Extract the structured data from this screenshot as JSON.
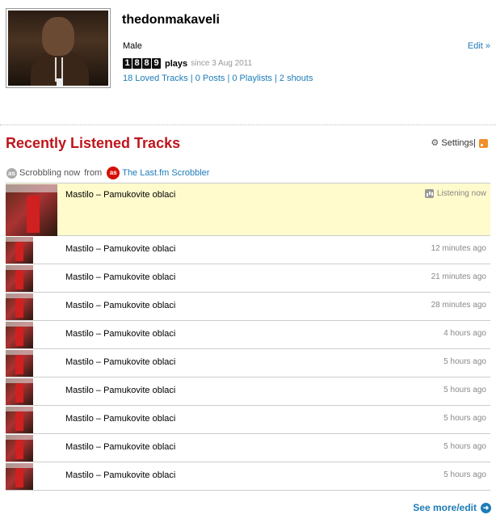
{
  "profile": {
    "username": "thedonmakaveli",
    "gender": "Male",
    "edit_label": "Edit »",
    "play_digits": [
      "1",
      "8",
      "8",
      "9"
    ],
    "plays_label": "plays",
    "since": "since 3 Aug 2011",
    "stats": {
      "loved": "18 Loved Tracks",
      "posts": "0 Posts",
      "playlists": "0 Playlists",
      "shouts": "2 shouts",
      "separator": " | "
    }
  },
  "section": {
    "title": "Recently Listened Tracks",
    "settings_label": "Settings",
    "settings_sep": " |"
  },
  "scrobbling": {
    "label": "Scrobbling now",
    "from": "from",
    "source": "The Last.fm Scrobbler"
  },
  "tracks": [
    {
      "name": "Mastilo – Pamukovite oblaci",
      "time": "Listening now"
    },
    {
      "name": "Mastilo – Pamukovite oblaci",
      "time": "12 minutes ago"
    },
    {
      "name": "Mastilo – Pamukovite oblaci",
      "time": "21 minutes ago"
    },
    {
      "name": "Mastilo – Pamukovite oblaci",
      "time": "28 minutes ago"
    },
    {
      "name": "Mastilo – Pamukovite oblaci",
      "time": "4 hours ago"
    },
    {
      "name": "Mastilo – Pamukovite oblaci",
      "time": "5 hours ago"
    },
    {
      "name": "Mastilo – Pamukovite oblaci",
      "time": "5 hours ago"
    },
    {
      "name": "Mastilo – Pamukovite oblaci",
      "time": "5 hours ago"
    },
    {
      "name": "Mastilo – Pamukovite oblaci",
      "time": "5 hours ago"
    },
    {
      "name": "Mastilo – Pamukovite oblaci",
      "time": "5 hours ago"
    }
  ],
  "footer": {
    "see_more_label": "See more/edit"
  },
  "colors": {
    "accent_red": "#c0141c",
    "link_blue": "#1d7cb8",
    "now_playing_bg": "#fffbcc"
  }
}
